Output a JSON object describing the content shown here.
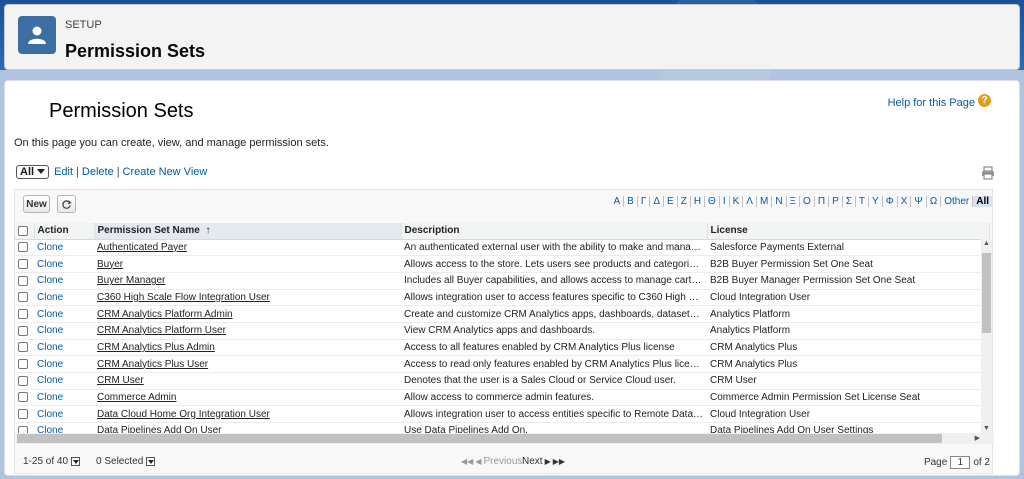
{
  "header": {
    "section": "SETUP",
    "title": "Permission Sets"
  },
  "page": {
    "title": "Permission Sets",
    "help_label": "Help for this Page",
    "intro": "On this page you can create, view, and manage permission sets."
  },
  "view": {
    "selected": "All",
    "edit": "Edit",
    "delete": "Delete",
    "create": "Create New View"
  },
  "toolbar": {
    "new_label": "New"
  },
  "alphabet": [
    "A",
    "Β",
    "Γ",
    "Δ",
    "Ε",
    "Ζ",
    "Η",
    "Θ",
    "Ι",
    "Κ",
    "Λ",
    "Μ",
    "Ν",
    "Ξ",
    "Ο",
    "Π",
    "Ρ",
    "Σ",
    "Τ",
    "Υ",
    "Φ",
    "Χ",
    "Ψ",
    "Ω",
    "Other",
    "All"
  ],
  "table": {
    "headers": {
      "action": "Action",
      "name": "Permission Set Name",
      "sort_indicator": "↑",
      "description": "Description",
      "license": "License"
    },
    "rows": [
      {
        "action": "Clone",
        "name": "Authenticated Payer",
        "description": "An authenticated external user with the ability to make and manage thei...",
        "license": "Salesforce Payments External"
      },
      {
        "action": "Clone",
        "name": "Buyer",
        "description": "Allows access to the store. Lets users see products and categories, ma...",
        "license": "B2B Buyer Permission Set One Seat"
      },
      {
        "action": "Clone",
        "name": "Buyer Manager",
        "description": "Includes all Buyer capabilities, and allows access to manage carts and ...",
        "license": "B2B Buyer Manager Permission Set One Seat"
      },
      {
        "action": "Clone",
        "name": "C360 High Scale Flow Integration User",
        "description": "Allows integration user to access features specific to C360 High Scale ...",
        "license": "Cloud Integration User"
      },
      {
        "action": "Clone",
        "name": "CRM Analytics Platform Admin",
        "description": "Create and customize CRM Analytics apps, dashboards, datasets and ...",
        "license": "Analytics Platform"
      },
      {
        "action": "Clone",
        "name": "CRM Analytics Platform User",
        "description": "View CRM Analytics apps and dashboards.",
        "license": "Analytics Platform"
      },
      {
        "action": "Clone",
        "name": "CRM Analytics Plus Admin",
        "description": "Access to all features enabled by CRM Analytics Plus license",
        "license": "CRM Analytics Plus"
      },
      {
        "action": "Clone",
        "name": "CRM Analytics Plus User",
        "description": "Access to read only features enabled by CRM Analytics Plus license",
        "license": "CRM Analytics Plus"
      },
      {
        "action": "Clone",
        "name": "CRM User",
        "description": "Denotes that the user is a Sales Cloud or Service Cloud user.",
        "license": "CRM User"
      },
      {
        "action": "Clone",
        "name": "Commerce Admin",
        "description": "Allow access to commerce admin features.",
        "license": "Commerce Admin Permission Set License Seat"
      },
      {
        "action": "Clone",
        "name": "Data Cloud Home Org Integration User",
        "description": "Allows integration user to access entities specific to Remote Data Cloud.",
        "license": "Cloud Integration User"
      },
      {
        "action": "Clone",
        "name": "Data Pipelines Add On User",
        "description": "Use Data Pipelines Add On.",
        "license": "Data Pipelines Add On User Settings"
      }
    ]
  },
  "footer": {
    "range": "1-25 of 40",
    "selected": "0 Selected",
    "previous": "Previous",
    "next": "Next",
    "page_label": "Page",
    "page_value": "1",
    "page_total": "of 2"
  }
}
